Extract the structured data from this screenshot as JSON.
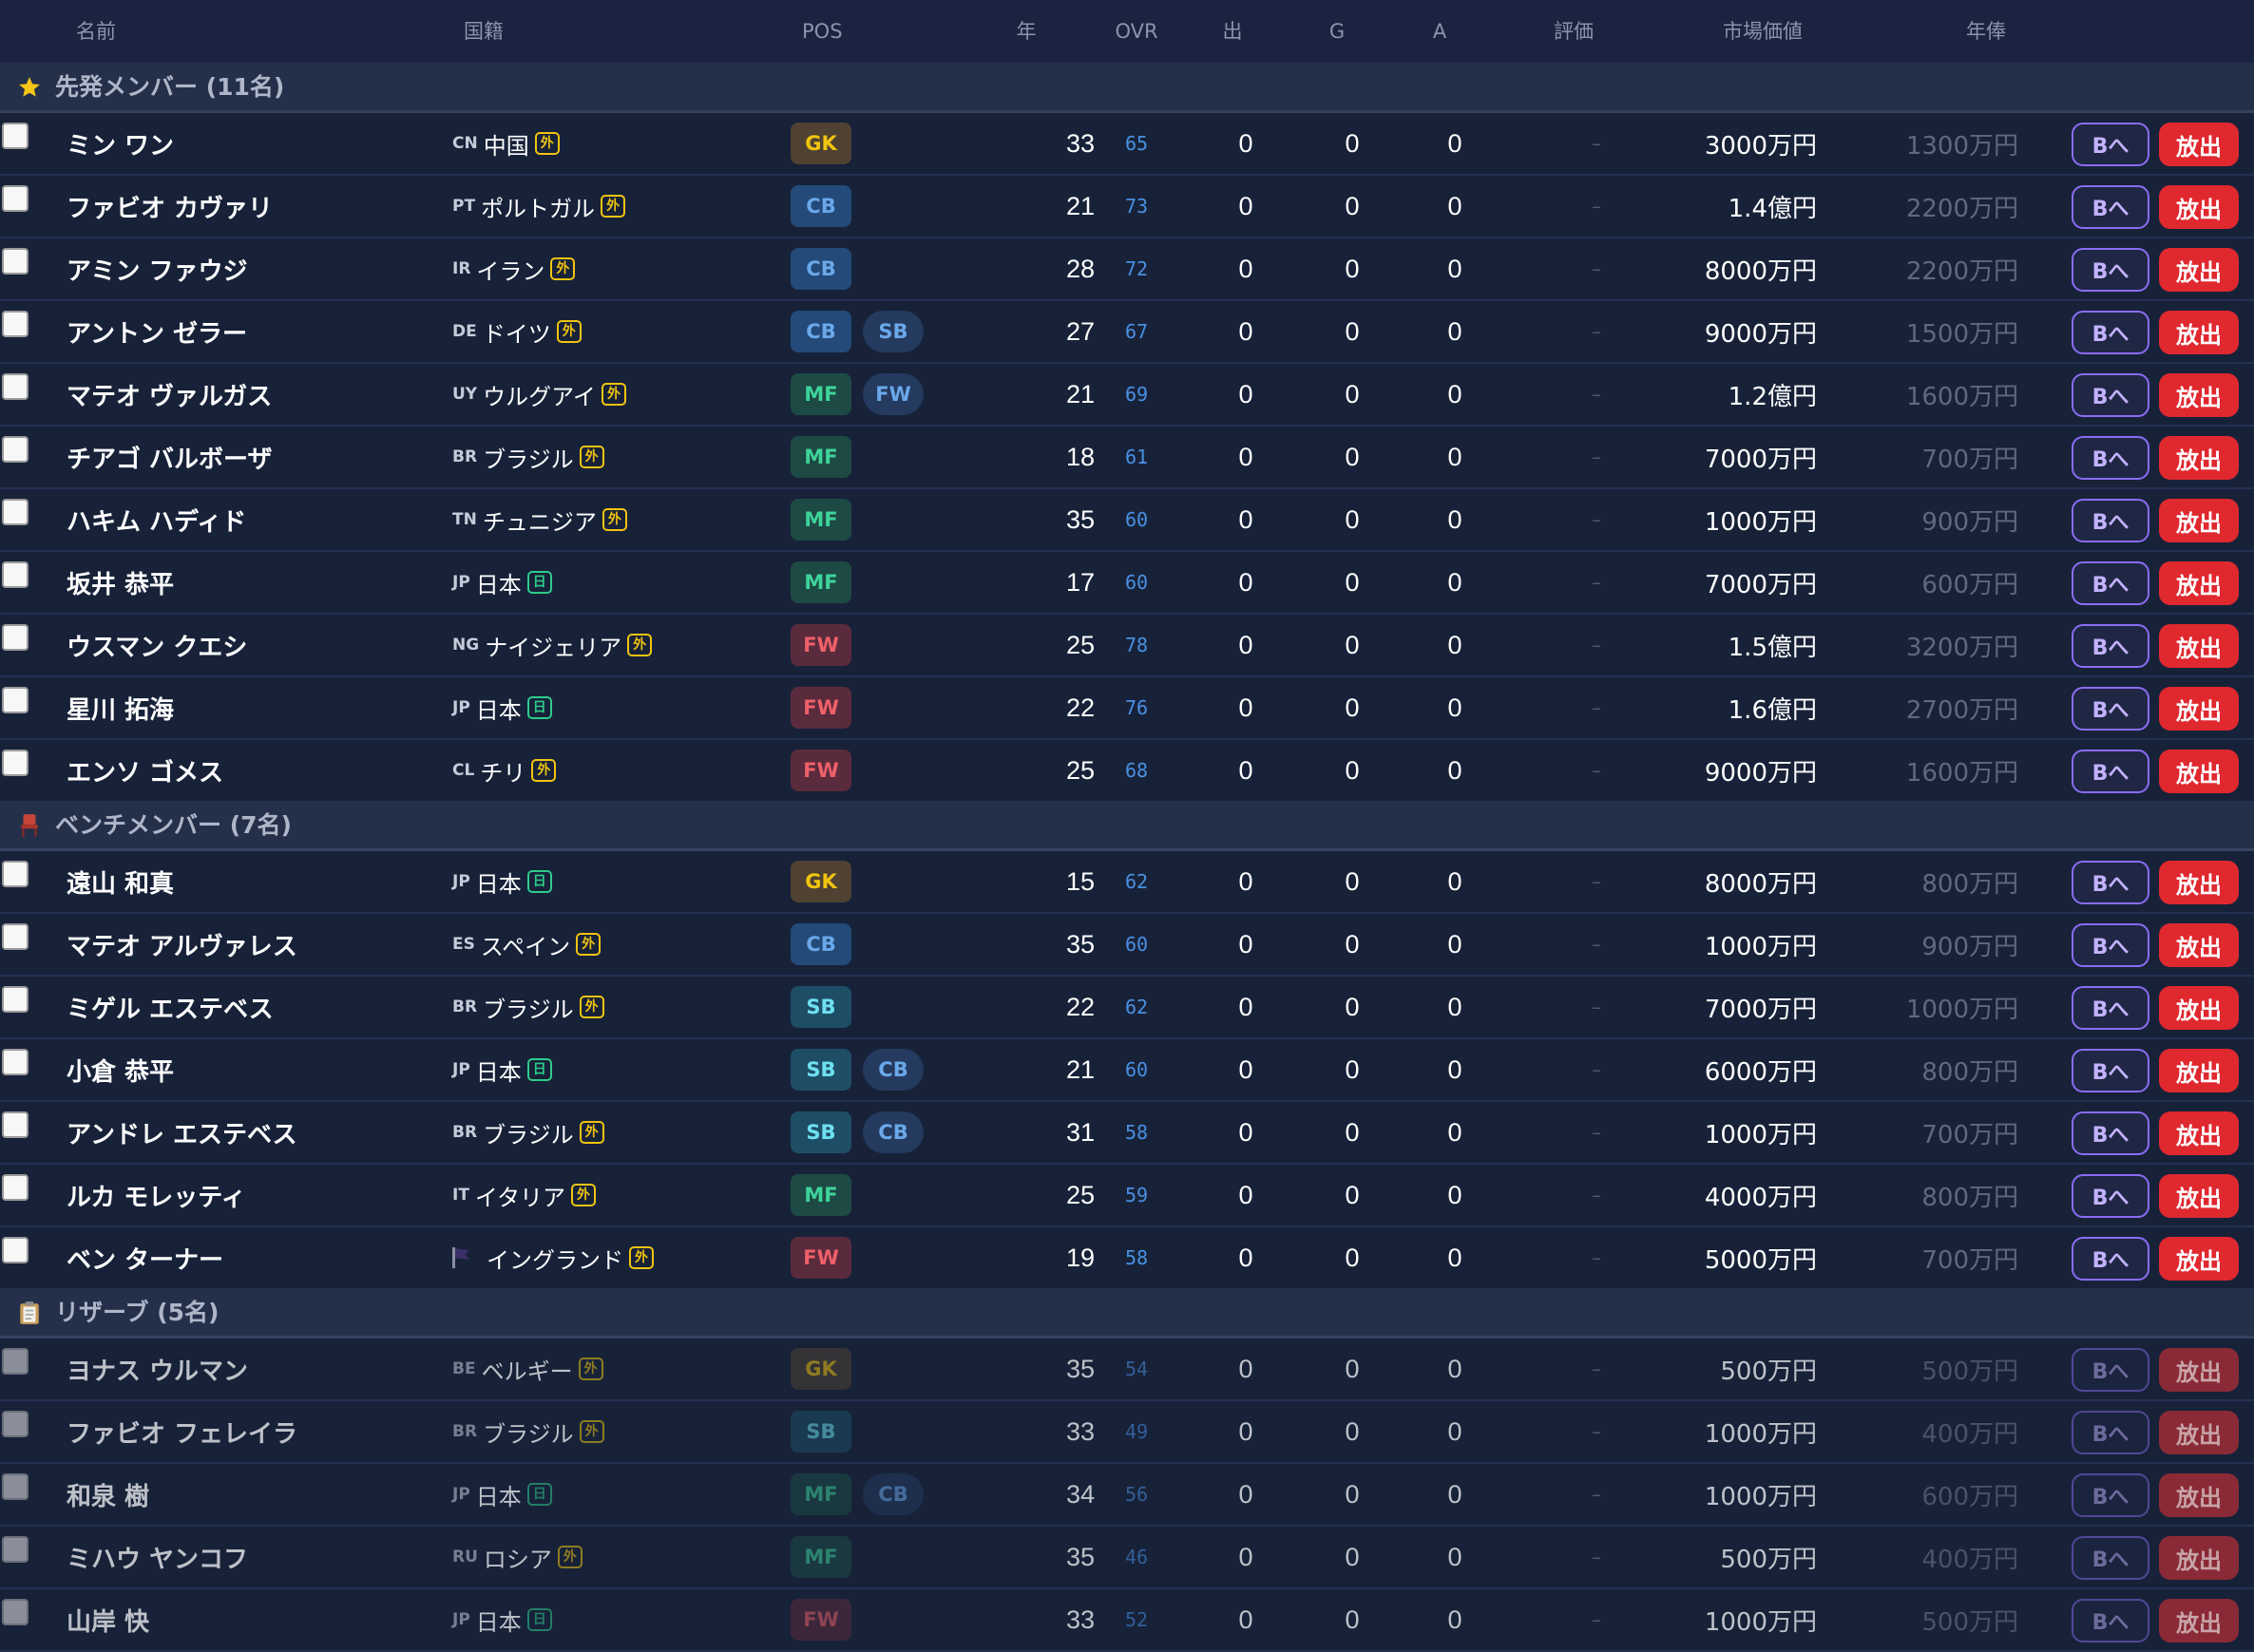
{
  "table_headers": {
    "name": "名前",
    "nationality": "国籍",
    "position": "POS",
    "age": "年",
    "ovr": "OVR",
    "apps": "出",
    "goals": "G",
    "assists": "A",
    "rating": "評価",
    "market_value": "市場価値",
    "wage": "年俸"
  },
  "colors": {
    "background": "#17213a",
    "header_row": "#24304a",
    "release_button": "#e0282f",
    "transfer_button_border": "#8b6cf5",
    "ovr_text": "#4a90e2",
    "foreign_tag": "#f1c40f",
    "domestic_tag": "#2ecc8a"
  },
  "buttons": {
    "transfer_label": "Bへ",
    "release_label": "放出"
  },
  "groups": [
    {
      "id": "starters",
      "title": "先発メンバー (11名)",
      "icon": "star-icon",
      "players": [
        {
          "name": "ミン ワン",
          "code": "CN",
          "nation": "中国",
          "tag": "外",
          "tag_type": "foreign",
          "positions": [
            "GK"
          ],
          "age": "33",
          "ovr": "65",
          "apps": "0",
          "goals": "0",
          "assists": "0",
          "rating": "–",
          "value": "3000万円",
          "wage": "1300万円"
        },
        {
          "name": "ファビオ カヴァリ",
          "code": "PT",
          "nation": "ポルトガル",
          "tag": "外",
          "tag_type": "foreign",
          "positions": [
            "CB"
          ],
          "age": "21",
          "ovr": "73",
          "apps": "0",
          "goals": "0",
          "assists": "0",
          "rating": "–",
          "value": "1.4億円",
          "wage": "2200万円"
        },
        {
          "name": "アミン ファウジ",
          "code": "IR",
          "nation": "イラン",
          "tag": "外",
          "tag_type": "foreign",
          "positions": [
            "CB"
          ],
          "age": "28",
          "ovr": "72",
          "apps": "0",
          "goals": "0",
          "assists": "0",
          "rating": "–",
          "value": "8000万円",
          "wage": "2200万円"
        },
        {
          "name": "アントン ゼラー",
          "code": "DE",
          "nation": "ドイツ",
          "tag": "外",
          "tag_type": "foreign",
          "positions": [
            "CB",
            "SB"
          ],
          "age": "27",
          "ovr": "67",
          "apps": "0",
          "goals": "0",
          "assists": "0",
          "rating": "–",
          "value": "9000万円",
          "wage": "1500万円"
        },
        {
          "name": "マテオ ヴァルガス",
          "code": "UY",
          "nation": "ウルグアイ",
          "tag": "外",
          "tag_type": "foreign",
          "positions": [
            "MF",
            "FW"
          ],
          "age": "21",
          "ovr": "69",
          "apps": "0",
          "goals": "0",
          "assists": "0",
          "rating": "–",
          "value": "1.2億円",
          "wage": "1600万円"
        },
        {
          "name": "チアゴ バルボーザ",
          "code": "BR",
          "nation": "ブラジル",
          "tag": "外",
          "tag_type": "foreign",
          "positions": [
            "MF"
          ],
          "age": "18",
          "ovr": "61",
          "apps": "0",
          "goals": "0",
          "assists": "0",
          "rating": "–",
          "value": "7000万円",
          "wage": "700万円"
        },
        {
          "name": "ハキム ハディド",
          "code": "TN",
          "nation": "チュニジア",
          "tag": "外",
          "tag_type": "foreign",
          "positions": [
            "MF"
          ],
          "age": "35",
          "ovr": "60",
          "apps": "0",
          "goals": "0",
          "assists": "0",
          "rating": "–",
          "value": "1000万円",
          "wage": "900万円"
        },
        {
          "name": "坂井 恭平",
          "code": "JP",
          "nation": "日本",
          "tag": "日",
          "tag_type": "domestic",
          "positions": [
            "MF"
          ],
          "age": "17",
          "ovr": "60",
          "apps": "0",
          "goals": "0",
          "assists": "0",
          "rating": "–",
          "value": "7000万円",
          "wage": "600万円"
        },
        {
          "name": "ウスマン クエシ",
          "code": "NG",
          "nation": "ナイジェリア",
          "tag": "外",
          "tag_type": "foreign",
          "positions": [
            "FW"
          ],
          "age": "25",
          "ovr": "78",
          "apps": "0",
          "goals": "0",
          "assists": "0",
          "rating": "–",
          "value": "1.5億円",
          "wage": "3200万円"
        },
        {
          "name": "星川 拓海",
          "code": "JP",
          "nation": "日本",
          "tag": "日",
          "tag_type": "domestic",
          "positions": [
            "FW"
          ],
          "age": "22",
          "ovr": "76",
          "apps": "0",
          "goals": "0",
          "assists": "0",
          "rating": "–",
          "value": "1.6億円",
          "wage": "2700万円"
        },
        {
          "name": "エンソ ゴメス",
          "code": "CL",
          "nation": "チリ",
          "tag": "外",
          "tag_type": "foreign",
          "positions": [
            "FW"
          ],
          "age": "25",
          "ovr": "68",
          "apps": "0",
          "goals": "0",
          "assists": "0",
          "rating": "–",
          "value": "9000万円",
          "wage": "1600万円"
        }
      ]
    },
    {
      "id": "bench",
      "title": "ベンチメンバー (7名)",
      "icon": "chair-icon",
      "players": [
        {
          "name": "遠山 和真",
          "code": "JP",
          "nation": "日本",
          "tag": "日",
          "tag_type": "domestic",
          "positions": [
            "GK"
          ],
          "age": "15",
          "ovr": "62",
          "apps": "0",
          "goals": "0",
          "assists": "0",
          "rating": "–",
          "value": "8000万円",
          "wage": "800万円"
        },
        {
          "name": "マテオ アルヴァレス",
          "code": "ES",
          "nation": "スペイン",
          "tag": "外",
          "tag_type": "foreign",
          "positions": [
            "CB"
          ],
          "age": "35",
          "ovr": "60",
          "apps": "0",
          "goals": "0",
          "assists": "0",
          "rating": "–",
          "value": "1000万円",
          "wage": "900万円"
        },
        {
          "name": "ミゲル エステベス",
          "code": "BR",
          "nation": "ブラジル",
          "tag": "外",
          "tag_type": "foreign",
          "positions": [
            "SB"
          ],
          "age": "22",
          "ovr": "62",
          "apps": "0",
          "goals": "0",
          "assists": "0",
          "rating": "–",
          "value": "7000万円",
          "wage": "1000万円"
        },
        {
          "name": "小倉 恭平",
          "code": "JP",
          "nation": "日本",
          "tag": "日",
          "tag_type": "domestic",
          "positions": [
            "SB",
            "CB"
          ],
          "age": "21",
          "ovr": "60",
          "apps": "0",
          "goals": "0",
          "assists": "0",
          "rating": "–",
          "value": "6000万円",
          "wage": "800万円"
        },
        {
          "name": "アンドレ エステベス",
          "code": "BR",
          "nation": "ブラジル",
          "tag": "外",
          "tag_type": "foreign",
          "positions": [
            "SB",
            "CB"
          ],
          "age": "31",
          "ovr": "58",
          "apps": "0",
          "goals": "0",
          "assists": "0",
          "rating": "–",
          "value": "1000万円",
          "wage": "700万円"
        },
        {
          "name": "ルカ モレッティ",
          "code": "IT",
          "nation": "イタリア",
          "tag": "外",
          "tag_type": "foreign",
          "positions": [
            "MF"
          ],
          "age": "25",
          "ovr": "59",
          "apps": "0",
          "goals": "0",
          "assists": "0",
          "rating": "–",
          "value": "4000万円",
          "wage": "800万円"
        },
        {
          "name": "ベン ターナー",
          "code": "",
          "flag_icon": "england-flag-icon",
          "nation": "イングランド",
          "tag": "外",
          "tag_type": "foreign",
          "positions": [
            "FW"
          ],
          "age": "19",
          "ovr": "58",
          "apps": "0",
          "goals": "0",
          "assists": "0",
          "rating": "–",
          "value": "5000万円",
          "wage": "700万円"
        }
      ]
    },
    {
      "id": "reserve",
      "title": "リザーブ (5名)",
      "icon": "clipboard-icon",
      "players": [
        {
          "name": "ヨナス ウルマン",
          "code": "BE",
          "nation": "ベルギー",
          "tag": "外",
          "tag_type": "foreign",
          "positions": [
            "GK"
          ],
          "age": "35",
          "ovr": "54",
          "apps": "0",
          "goals": "0",
          "assists": "0",
          "rating": "–",
          "value": "500万円",
          "wage": "500万円"
        },
        {
          "name": "ファビオ フェレイラ",
          "code": "BR",
          "nation": "ブラジル",
          "tag": "外",
          "tag_type": "foreign",
          "positions": [
            "SB"
          ],
          "age": "33",
          "ovr": "49",
          "apps": "0",
          "goals": "0",
          "assists": "0",
          "rating": "–",
          "value": "1000万円",
          "wage": "400万円"
        },
        {
          "name": "和泉 樹",
          "code": "JP",
          "nation": "日本",
          "tag": "日",
          "tag_type": "domestic",
          "positions": [
            "MF",
            "CB"
          ],
          "age": "34",
          "ovr": "56",
          "apps": "0",
          "goals": "0",
          "assists": "0",
          "rating": "–",
          "value": "1000万円",
          "wage": "600万円"
        },
        {
          "name": "ミハウ ヤンコフ",
          "code": "RU",
          "nation": "ロシア",
          "tag": "外",
          "tag_type": "foreign",
          "positions": [
            "MF"
          ],
          "age": "35",
          "ovr": "46",
          "apps": "0",
          "goals": "0",
          "assists": "0",
          "rating": "–",
          "value": "500万円",
          "wage": "400万円"
        },
        {
          "name": "山岸 快",
          "code": "JP",
          "nation": "日本",
          "tag": "日",
          "tag_type": "domestic",
          "positions": [
            "FW"
          ],
          "age": "33",
          "ovr": "52",
          "apps": "0",
          "goals": "0",
          "assists": "0",
          "rating": "–",
          "value": "1000万円",
          "wage": "500万円"
        }
      ]
    }
  ]
}
